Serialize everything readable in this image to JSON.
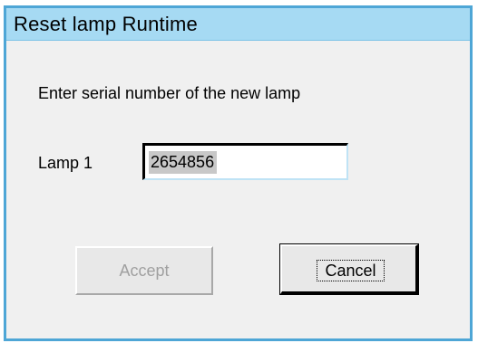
{
  "dialog": {
    "title": "Reset lamp Runtime",
    "prompt": "Enter serial number of the new lamp",
    "lamp_label": "Lamp 1",
    "serial_value": "2654856",
    "accept_label": "Accept",
    "cancel_label": "Cancel"
  },
  "colors": {
    "titlebar": "#a6daf3",
    "border": "#4ea6d6",
    "background": "#f0f0f0"
  }
}
